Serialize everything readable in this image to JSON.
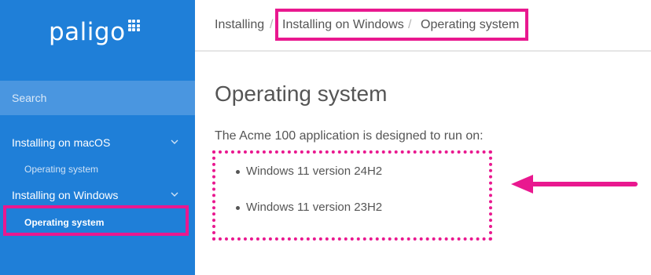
{
  "brand": {
    "name": "paligo"
  },
  "sidebar": {
    "search_label": "Search",
    "items": [
      {
        "label": "Installing on macOS",
        "type": "section",
        "icon": "chevron-down-icon"
      },
      {
        "label": "Operating system",
        "type": "sub"
      },
      {
        "label": "Installing on Windows",
        "type": "section",
        "icon": "chevron-down-icon"
      },
      {
        "label": "Operating system",
        "type": "sub",
        "active": true
      }
    ]
  },
  "breadcrumb": [
    {
      "label": "Installing"
    },
    {
      "label": "Installing on Windows"
    },
    {
      "label": "Operating system"
    }
  ],
  "breadcrumb_separator": "/",
  "main": {
    "title": "Operating system",
    "intro": "The Acme 100 application is designed to run on:",
    "list": [
      "Windows 11 version 24H2",
      "Windows 11 version 23H2"
    ]
  },
  "colors": {
    "sidebar": "#1f7fd8",
    "search": "#4a96e0",
    "highlight": "#e9188f",
    "text": "#555555"
  }
}
